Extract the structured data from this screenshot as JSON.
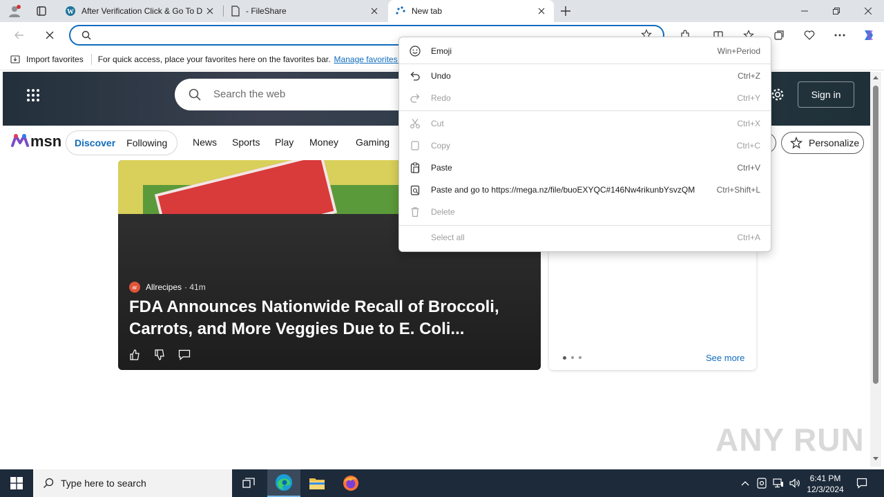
{
  "tabs": [
    {
      "title": "After Verification Click & Go To D",
      "icon": "wordpress-icon"
    },
    {
      "title": "- FileShare",
      "icon": "page-icon"
    },
    {
      "title": "New tab",
      "icon": "loading-icon"
    }
  ],
  "address": {
    "value": "",
    "placeholder": ""
  },
  "favorites_bar": {
    "import_label": "Import favorites",
    "hint": "For quick access, place your favorites here on the favorites bar.",
    "manage_link": "Manage favorites n"
  },
  "msn": {
    "search_placeholder": "Search the web",
    "sign_in": "Sign in",
    "logo_text": "msn",
    "pill_tabs": [
      "Discover",
      "Following"
    ],
    "nav": [
      "News",
      "Sports",
      "Play",
      "Money",
      "Gaming"
    ],
    "personalize": "Personalize"
  },
  "article": {
    "source": "Allrecipes",
    "time": "· 41m",
    "headline_line1": "FDA Announces Nationwide Recall of Broccoli,",
    "headline_line2": "Carrots, and More Veggies Due to E. Coli..."
  },
  "side_card": {
    "see_more": "See more"
  },
  "context_menu": {
    "items": [
      {
        "label": "Emoji",
        "shortcut": "Win+Period",
        "disabled": false
      },
      {
        "label": "Undo",
        "shortcut": "Ctrl+Z",
        "disabled": false
      },
      {
        "label": "Redo",
        "shortcut": "Ctrl+Y",
        "disabled": true
      },
      {
        "label": "Cut",
        "shortcut": "Ctrl+X",
        "disabled": true
      },
      {
        "label": "Copy",
        "shortcut": "Ctrl+C",
        "disabled": true
      },
      {
        "label": "Paste",
        "shortcut": "Ctrl+V",
        "disabled": false
      },
      {
        "label": "Paste and go to https://mega.nz/file/buoEXYQC#146Nw4rikunbYsvzQM-...",
        "shortcut": "Ctrl+Shift+L",
        "disabled": false
      },
      {
        "label": "Delete",
        "shortcut": "",
        "disabled": true
      },
      {
        "label": "Select all",
        "shortcut": "Ctrl+A",
        "disabled": true
      }
    ]
  },
  "taskbar": {
    "search_placeholder": "Type here to search",
    "time": "6:41 PM",
    "date": "12/3/2024"
  },
  "watermark": "ANY RUN",
  "colors": {
    "accent": "#0f6cbd",
    "taskbar": "#1c2a3a",
    "tabstrip": "#dfe3e8"
  }
}
